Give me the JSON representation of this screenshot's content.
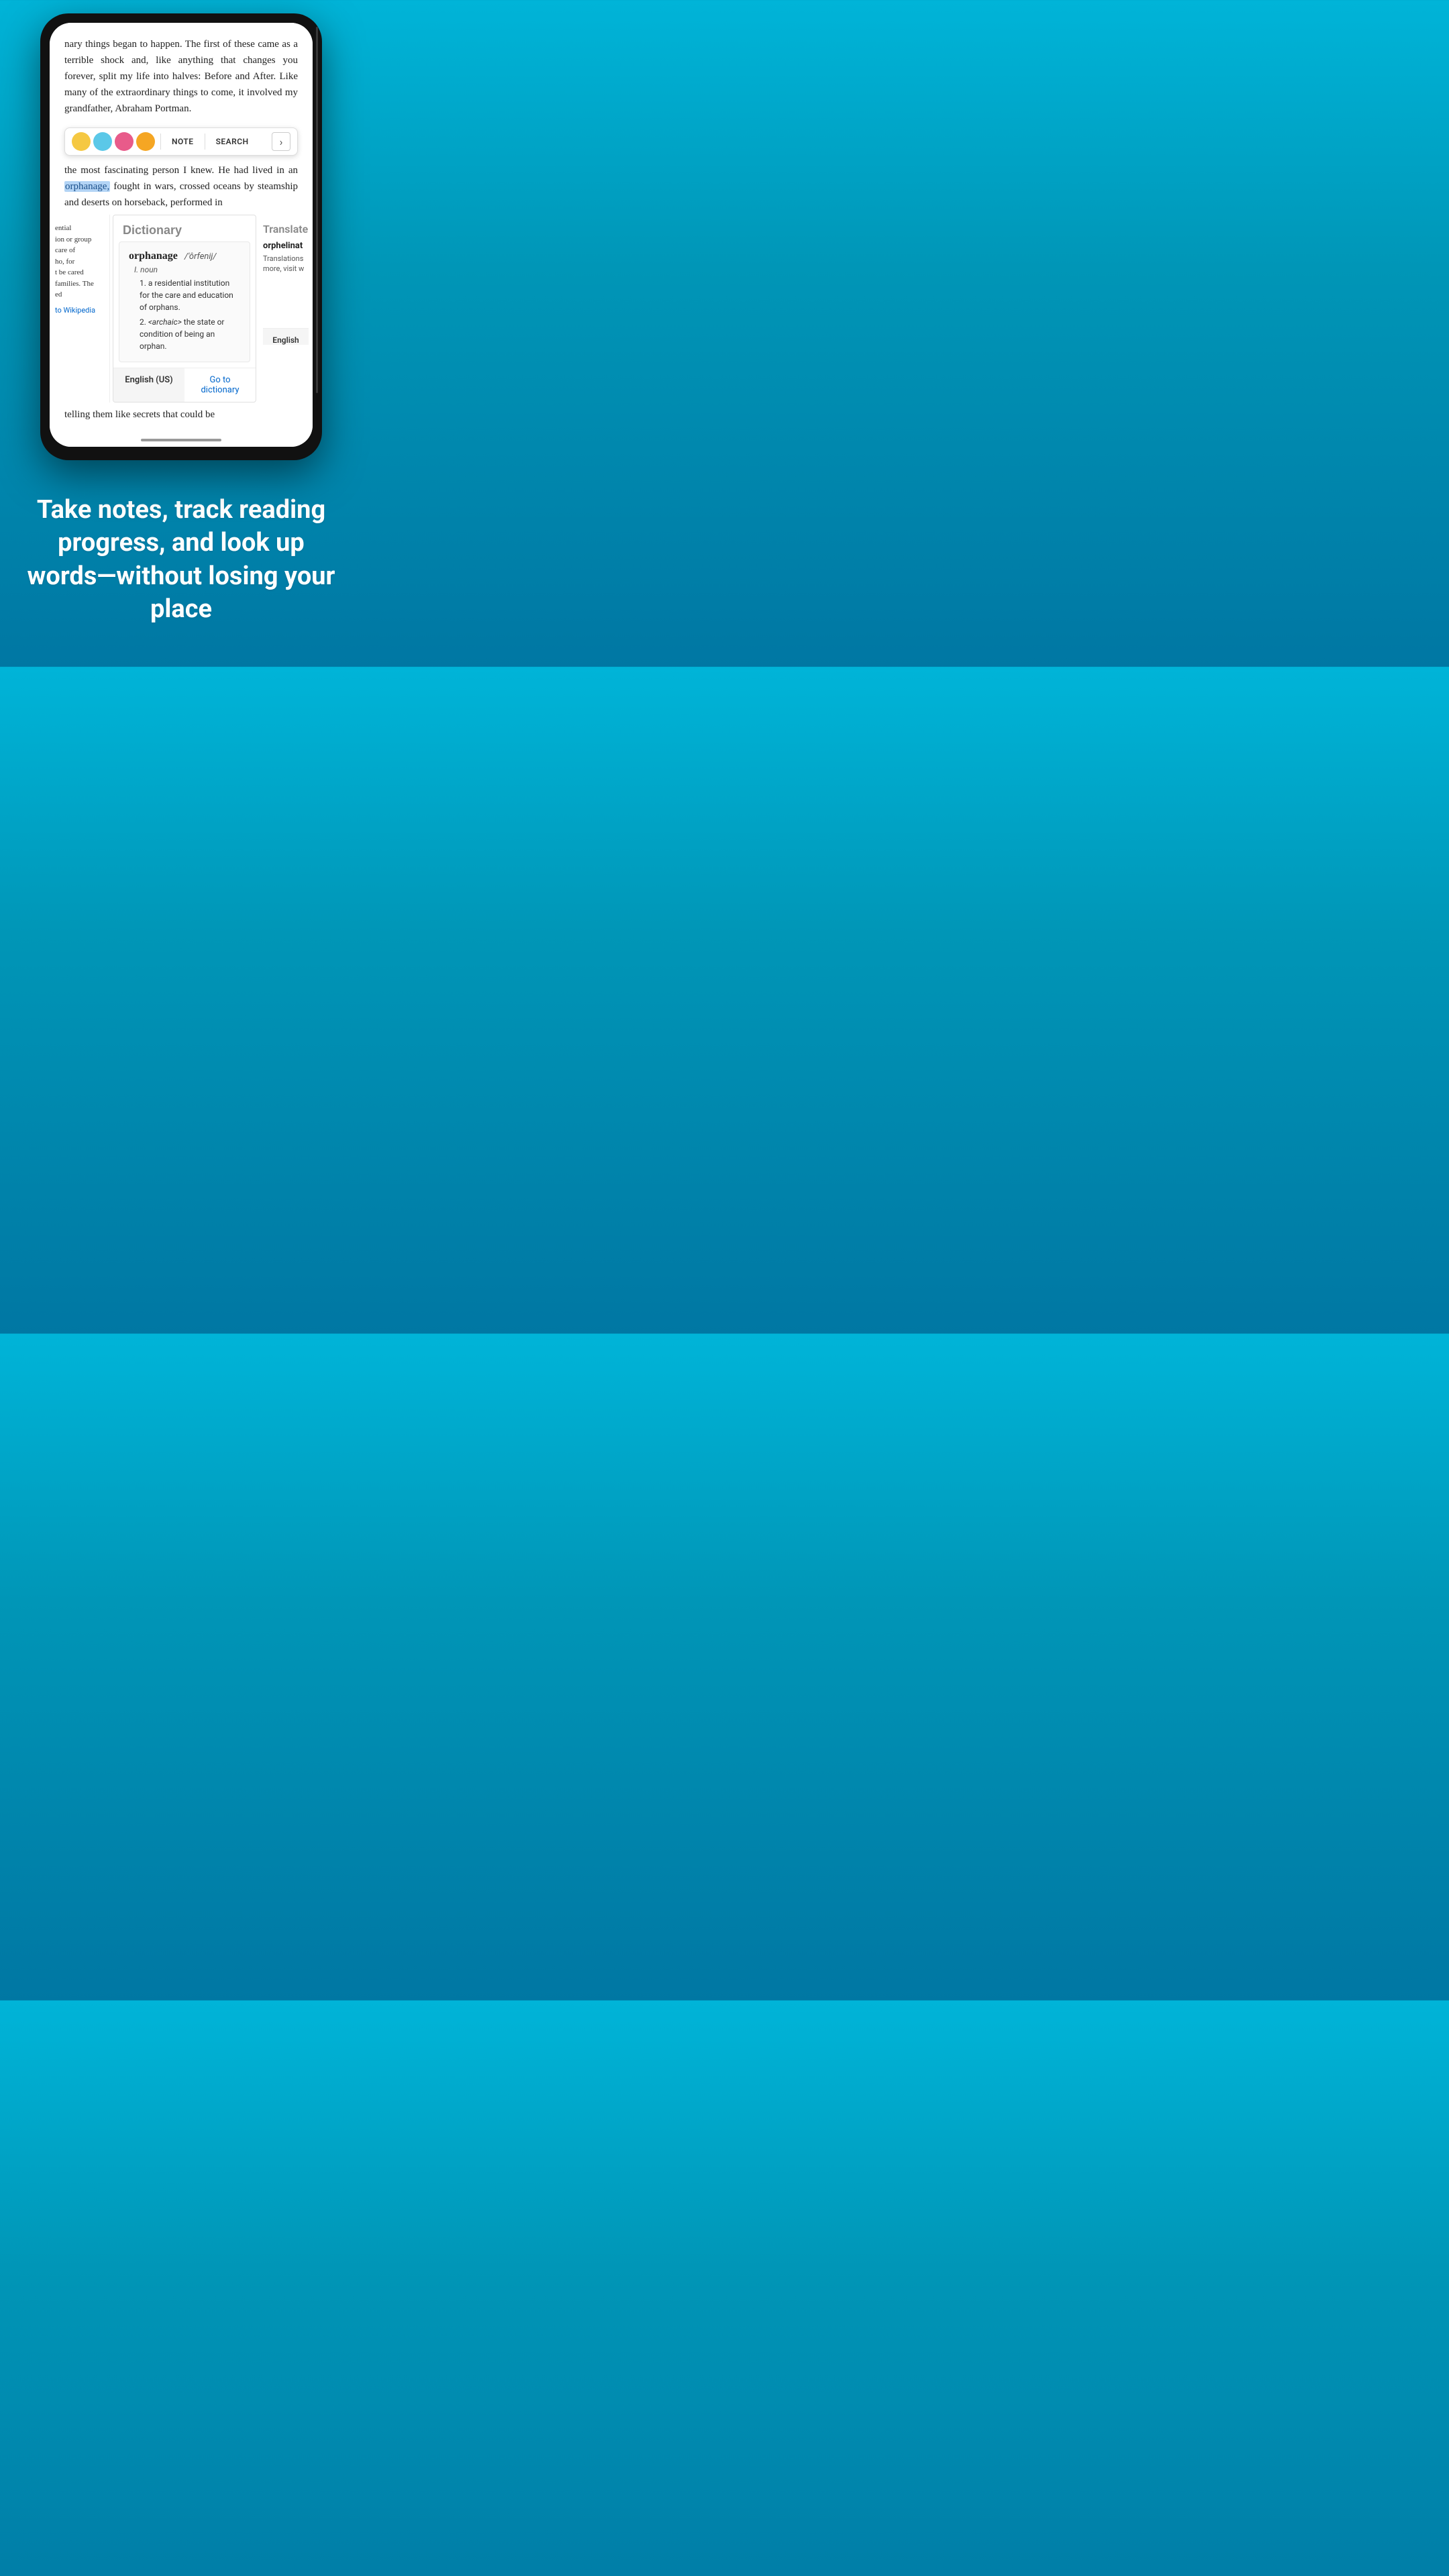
{
  "background": {
    "gradient_start": "#00b4d8",
    "gradient_end": "#0077a3"
  },
  "phone": {
    "book_text_top": "nary things began to happen. The first of these came as a terrible shock and, like anything that changes you forever, split my life into halves: Before and After. Like many of the extraordinary things to come, it involved my grandfather, Abraham Portman.",
    "book_text_middle": "the most fascinating person I knew. He had lived in an",
    "highlighted_word": "orphanage,",
    "book_text_after_highlight": "fought in wars, crossed oceans by steamship and deserts on horseback, performed in",
    "book_text_bottom": "telling them like secrets that could be",
    "toolbar": {
      "colors": [
        {
          "name": "yellow",
          "hex": "#f5c842"
        },
        {
          "name": "blue",
          "hex": "#5bc8e8"
        },
        {
          "name": "pink",
          "hex": "#e85b8a"
        },
        {
          "name": "orange",
          "hex": "#f5a623"
        }
      ],
      "note_label": "NOTE",
      "search_label": "SEARCH",
      "arrow_label": "›"
    },
    "left_panel": {
      "text_lines": [
        "ential",
        "ion or group",
        "care of",
        "ho, for",
        "t be cared",
        "families. The",
        "ed"
      ],
      "wikipedia_link": "to Wikipedia"
    },
    "dictionary": {
      "header": "Dictionary",
      "word": "orphanage",
      "phonetic": "/'ôrfenij/",
      "part_of_speech": "I. noun",
      "definitions": [
        {
          "number": "1",
          "text": "a residential institution for the care and education of orphans."
        },
        {
          "number": "2",
          "text": "<archaic> the state or condition of being an orphan."
        }
      ],
      "footer_left": "English (US)",
      "footer_right": "Go to dictionary"
    },
    "right_panel": {
      "header": "Translate",
      "word": "orphelinat",
      "text": "Translations more, visit w",
      "footer": "English"
    }
  },
  "tagline": "Take notes, track reading progress, and look up words—without losing your place"
}
